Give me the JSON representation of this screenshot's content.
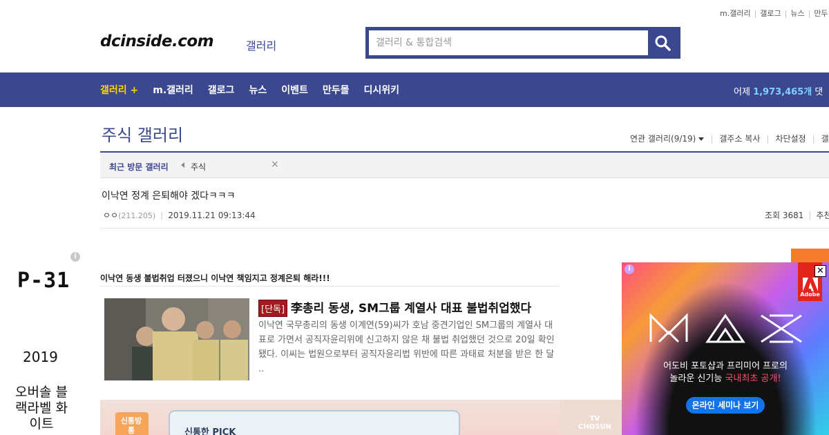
{
  "header": {
    "util_links": [
      "m.갤러리",
      "갤로그",
      "뉴스",
      "만두"
    ],
    "logo": "dcinside.com",
    "logo_sub": "갤러리",
    "search_placeholder": "갤러리 & 통합검색"
  },
  "nav": {
    "items": [
      "갤러리 +",
      "m.갤러리",
      "갤로그",
      "뉴스",
      "이벤트",
      "만두몰",
      "디시위키"
    ],
    "stats_prefix": "어제",
    "stats_value": "1,973,465개",
    "stats_suffix": "댓"
  },
  "gallery": {
    "title": "주식 갤러리",
    "tools": [
      "연관 갤러리(9/19)",
      "갤주소 복사",
      "차단설정",
      "갤러"
    ]
  },
  "recent": {
    "label": "최근 방문 갤러리",
    "item": "주식",
    "close": "×"
  },
  "post": {
    "title": "이낙연 정계 은퇴해야 겠다ㅋㅋㅋ",
    "author": "ㅇㅇ",
    "ip": "(211.205)",
    "date": "2019.11.21 09:13:44",
    "views": "조회 3681",
    "recommend": "추천"
  },
  "body": {
    "line1": "이낙연 동생 불법취업 터졌으니 이낙연 책임지고 정계은퇴 해라!!!",
    "news_tag": "[단독]",
    "news_headline": "李총리 동생, SM그룹 계열사 대표 불법취업했다",
    "news_summary": "이낙연 국무총리의 동생 이계연(59)씨가 호남 중견기업인 SM그룹의 계열사 대표로 가면서 공직자윤리위에 신고하지 않은 채 불법 취업했던 것으로 20일 확인됐다. 이씨는 법원으로부터 공직자윤리법 위반에 따른 과태료 처분을 받은 한 달 ..",
    "video_caption": "신통한 PICK",
    "video_badge": "신통방통",
    "video_brand": "TV CHOSUN"
  },
  "left_ad": {
    "info": "i",
    "title": "P-31",
    "year": "2019",
    "desc": "오버솔 블랙라벨 화이트"
  },
  "right_ad": {
    "info": "i",
    "brand": "Adobe",
    "close": "✕",
    "logo_text": "MAX",
    "line1": "어도비 포토샵과 프리미어 프로의",
    "line2_prefix": "놀라운 신기능 ",
    "line2_highlight": "국내최초 공개!",
    "cta": "온라인 세미나 보기",
    "accent_color": "#1473e6",
    "brand_color": "#e1251b"
  }
}
